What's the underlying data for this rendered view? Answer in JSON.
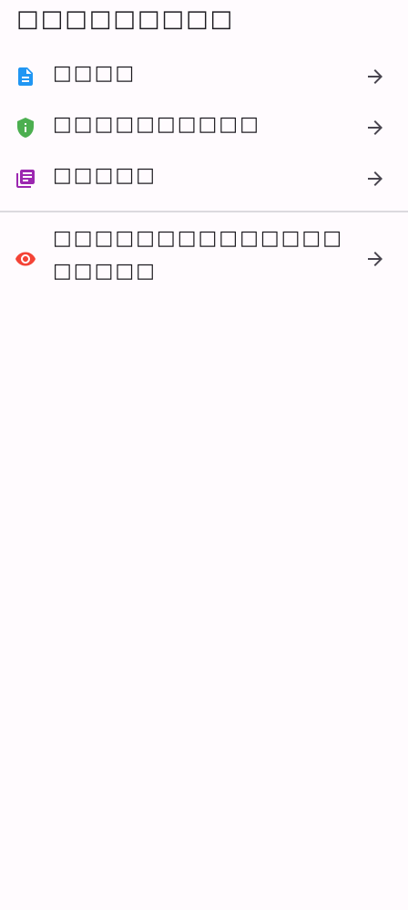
{
  "header": {
    "title": "□□□□□□□□□"
  },
  "menu": {
    "items": [
      {
        "label": "□□□□",
        "icon": "document-icon",
        "icon_color": "#2196f3"
      },
      {
        "label": "□□□□□□□□□□",
        "icon": "shield-info-icon",
        "icon_color": "#4caf50"
      },
      {
        "label": "□□□□□",
        "icon": "library-books-icon",
        "icon_color": "#9c27b0"
      }
    ]
  },
  "extra": {
    "items": [
      {
        "label": "□□□□□□□□□□□□□□□□□□□",
        "icon": "eye-icon",
        "icon_color": "#f44336"
      }
    ]
  },
  "trailing_icon": "arrow-right-icon"
}
